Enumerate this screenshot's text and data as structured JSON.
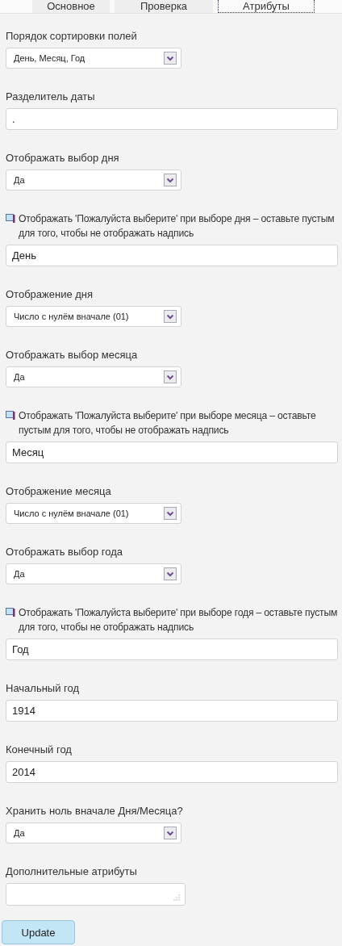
{
  "tabs": [
    {
      "label": "Основное",
      "selected": false
    },
    {
      "label": "Проверка",
      "selected": false
    },
    {
      "label": "Атрибуты",
      "selected": true
    }
  ],
  "fields": [
    {
      "kind": "select",
      "label": "Порядок сортировки полей",
      "value": "День, Месяц, Год"
    },
    {
      "kind": "text",
      "label": "Разделитель даты",
      "value": "."
    },
    {
      "kind": "select",
      "label": "Отображать выбор дня",
      "value": "Да"
    },
    {
      "kind": "text",
      "label": "Отображать 'Пожалуйста выберите' при выборе дня – оставьте пустым для того, чтобы не отображать надпись",
      "has_icon": true,
      "value": "День"
    },
    {
      "kind": "select",
      "label": "Отображение дня",
      "value": "Число с нулём вначале (01)"
    },
    {
      "kind": "select",
      "label": "Отображать выбор месяца",
      "value": "Да"
    },
    {
      "kind": "text",
      "label": "Отображать 'Пожалуйста выберите' при выборе месяца – оставьте пустым для того, чтобы не отображать надпись",
      "has_icon": true,
      "value": "Месяц"
    },
    {
      "kind": "select",
      "label": "Отображение месяца",
      "value": "Число с нулём вначале (01)"
    },
    {
      "kind": "select",
      "label": "Отображать выбор года",
      "value": "Да"
    },
    {
      "kind": "text",
      "label": "Отображать 'Пожалуйста выберите' при выборе годя – оставьте пустым для того, чтобы не отображать надпись",
      "has_icon": true,
      "value": "Год"
    },
    {
      "kind": "text",
      "label": "Начальный год",
      "value": "1914"
    },
    {
      "kind": "text",
      "label": "Конечный год",
      "value": "2014"
    },
    {
      "kind": "select",
      "label": "Хранить ноль вначале Дня/Месяца?",
      "value": "Да"
    },
    {
      "kind": "textarea",
      "label": "Дополнительные атрибуты"
    }
  ],
  "button": "Update"
}
